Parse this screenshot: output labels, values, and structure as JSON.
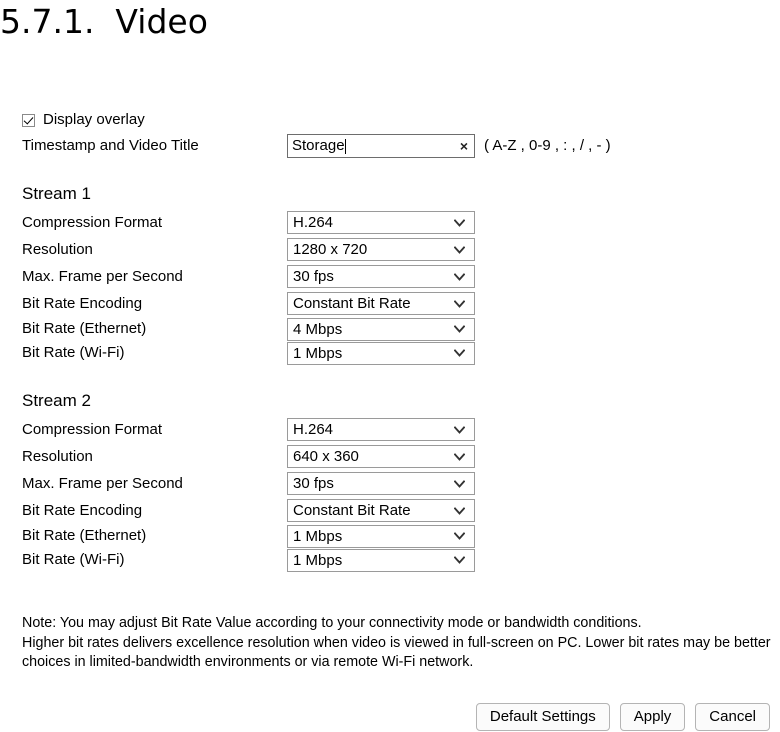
{
  "page": {
    "title": "5.7.1.  Video"
  },
  "overlay": {
    "checkbox_label": "Display overlay",
    "checked": true,
    "title_label": "Timestamp and Video Title",
    "title_value": "Storage",
    "title_placeholder": "",
    "clear_icon": "×",
    "hint": "( A-Z , 0-9 , : , / , - )"
  },
  "streams": [
    {
      "heading": "Stream 1",
      "fields": [
        {
          "label": "Compression Format",
          "value": "H.264"
        },
        {
          "label": "Resolution",
          "value": "1280 x 720"
        },
        {
          "label": "Max. Frame per Second",
          "value": "30 fps"
        },
        {
          "label": "Bit Rate Encoding",
          "value": "Constant Bit Rate"
        },
        {
          "label": "Bit Rate (Ethernet)",
          "value": "4 Mbps"
        },
        {
          "label": "Bit Rate (Wi-Fi)",
          "value": "1 Mbps"
        }
      ]
    },
    {
      "heading": "Stream 2",
      "fields": [
        {
          "label": "Compression Format",
          "value": "H.264"
        },
        {
          "label": "Resolution",
          "value": "640 x 360"
        },
        {
          "label": "Max. Frame per Second",
          "value": "30 fps"
        },
        {
          "label": "Bit Rate Encoding",
          "value": "Constant Bit Rate"
        },
        {
          "label": "Bit Rate (Ethernet)",
          "value": "1 Mbps"
        },
        {
          "label": "Bit Rate (Wi-Fi)",
          "value": "1 Mbps"
        }
      ]
    }
  ],
  "note": {
    "line1": "Note: You may adjust Bit Rate Value according to your connectivity mode or bandwidth conditions.",
    "line2": "Higher bit rates delivers excellence resolution when video is viewed in full-screen on PC. Lower bit rates may be better choices in limited-bandwidth environments or via remote Wi-Fi network."
  },
  "buttons": {
    "default_settings": "Default Settings",
    "apply": "Apply",
    "cancel": "Cancel"
  }
}
